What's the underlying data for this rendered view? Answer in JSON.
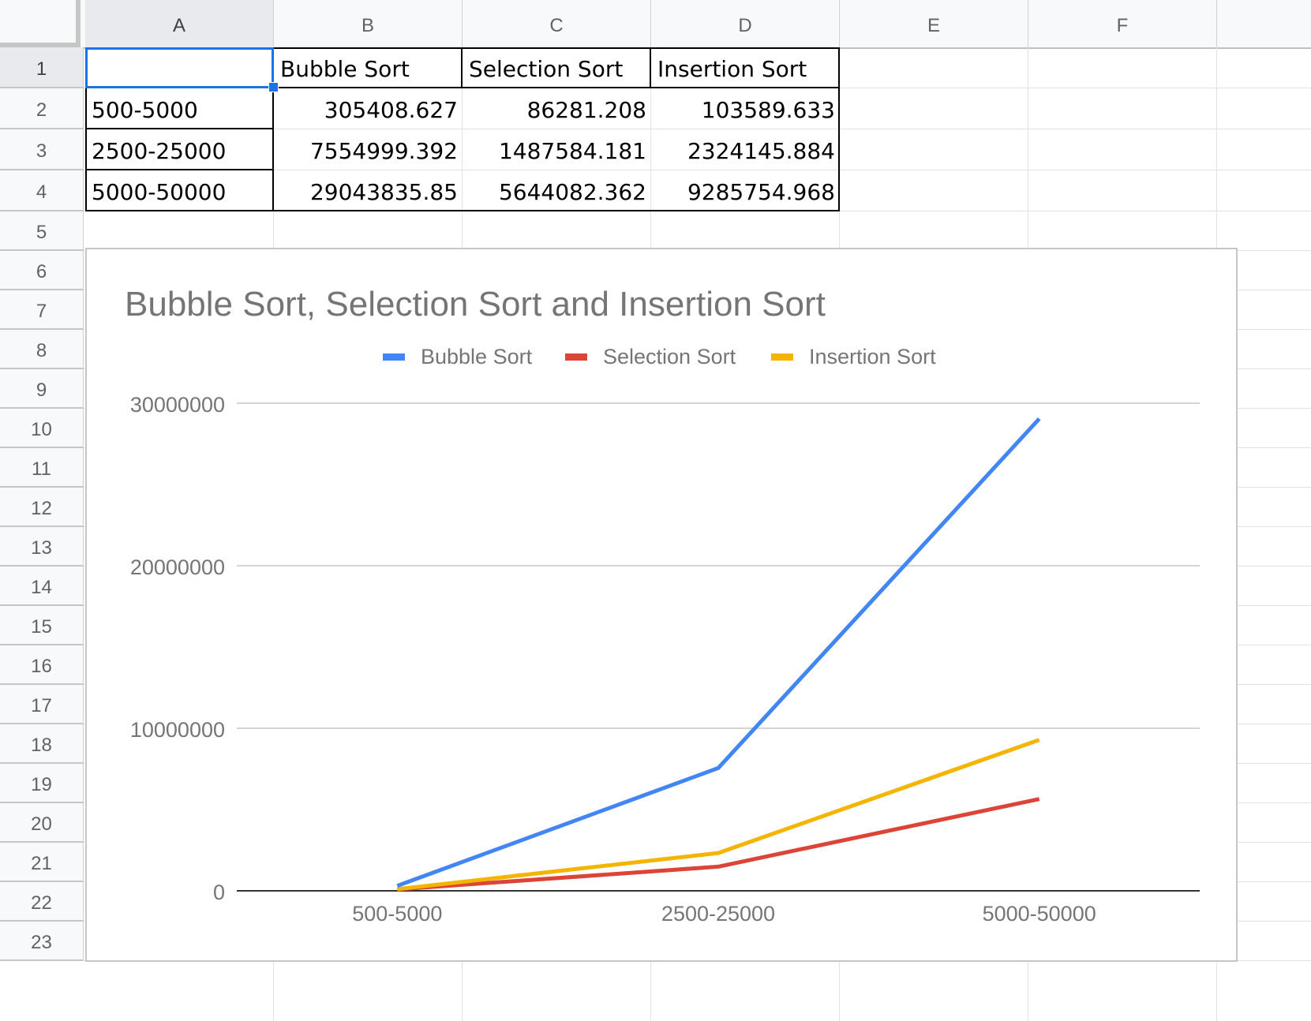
{
  "sheet": {
    "columns": [
      "A",
      "B",
      "C",
      "D",
      "E",
      "F"
    ],
    "rows": [
      "1",
      "2",
      "3",
      "4",
      "5",
      "6",
      "7",
      "8",
      "9",
      "10",
      "11",
      "12",
      "13",
      "14",
      "15",
      "16",
      "17",
      "18",
      "19",
      "20",
      "21",
      "22",
      "23"
    ],
    "cells": {
      "A1": "",
      "B1": "Bubble Sort",
      "C1": "Selection Sort",
      "D1": "Insertion Sort",
      "A2": "500-5000",
      "B2": "305408.627",
      "C2": "86281.208",
      "D2": "103589.633",
      "A3": "2500-25000",
      "B3": "7554999.392",
      "C3": "1487584.181",
      "D3": "2324145.884",
      "A4": "5000-50000",
      "B4": "29043835.85",
      "C4": "5644082.362",
      "D4": "9285754.968"
    },
    "active_cell": "A1"
  },
  "chart_data": {
    "type": "line",
    "title": "Bubble Sort, Selection Sort and Insertion Sort",
    "categories": [
      "500-5000",
      "2500-25000",
      "5000-50000"
    ],
    "series": [
      {
        "name": "Bubble Sort",
        "color": "#4285f4",
        "values": [
          305408.627,
          7554999.392,
          29043835.85
        ]
      },
      {
        "name": "Selection Sort",
        "color": "#db4437",
        "values": [
          86281.208,
          1487584.181,
          5644082.362
        ]
      },
      {
        "name": "Insertion Sort",
        "color": "#f4b400",
        "values": [
          103589.633,
          2324145.884,
          9285754.968
        ]
      }
    ],
    "y_ticks": [
      "0",
      "10000000",
      "20000000",
      "30000000"
    ],
    "ylim": [
      0,
      30000000
    ],
    "xlabel": "",
    "ylabel": "",
    "grid": true,
    "legend_position": "top"
  }
}
